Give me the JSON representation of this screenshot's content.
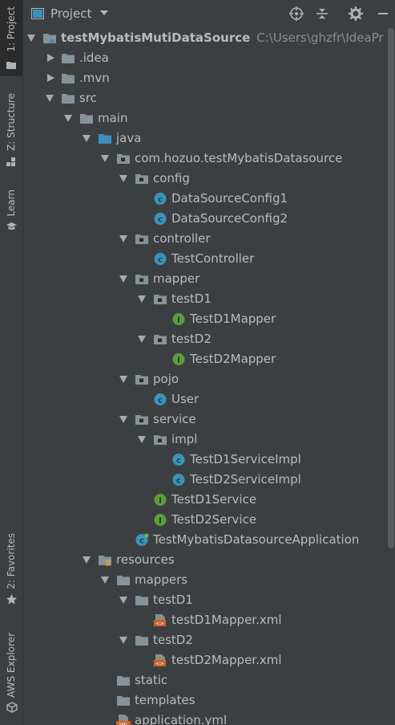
{
  "sidebar": {
    "tabs": [
      {
        "label": "1: Project",
        "icon": "folder-icon"
      },
      {
        "label": "Z: Structure",
        "icon": "structure-icon"
      },
      {
        "label": "Learn",
        "icon": "learn-cap-icon"
      },
      {
        "label": "2: Favorites",
        "icon": "star-icon"
      },
      {
        "label": "AWS Explorer",
        "icon": "aws-cube-icon"
      }
    ]
  },
  "header": {
    "title": "Project",
    "icons": [
      "locate-icon",
      "collapse-all-icon",
      "settings-gear-icon",
      "hide-minus-icon"
    ]
  },
  "tree": {
    "rows": [
      {
        "label": "testMybatisMutiDataSource",
        "extra": "C:\\Users\\ghzfr\\IdeaProjects",
        "icon": "module-folder-icon",
        "arrow": "down",
        "bold": true
      },
      {
        "label": ".idea",
        "icon": "folder-icon",
        "arrow": "right"
      },
      {
        "label": ".mvn",
        "icon": "folder-icon",
        "arrow": "right"
      },
      {
        "label": "src",
        "icon": "folder-icon",
        "arrow": "down"
      },
      {
        "label": "main",
        "icon": "folder-icon",
        "arrow": "down"
      },
      {
        "label": "java",
        "icon": "source-folder-icon",
        "arrow": "down"
      },
      {
        "label": "com.hozuo.testMybatisDatasource",
        "icon": "package-icon",
        "arrow": "down"
      },
      {
        "label": "config",
        "icon": "package-icon",
        "arrow": "down"
      },
      {
        "label": "DataSourceConfig1",
        "icon": "class-icon"
      },
      {
        "label": "DataSourceConfig2",
        "icon": "class-icon"
      },
      {
        "label": "controller",
        "icon": "package-icon",
        "arrow": "down"
      },
      {
        "label": "TestController",
        "icon": "class-icon"
      },
      {
        "label": "mapper",
        "icon": "package-icon",
        "arrow": "down"
      },
      {
        "label": "testD1",
        "icon": "package-icon",
        "arrow": "down"
      },
      {
        "label": "TestD1Mapper",
        "icon": "interface-icon"
      },
      {
        "label": "testD2",
        "icon": "package-icon",
        "arrow": "down"
      },
      {
        "label": "TestD2Mapper",
        "icon": "interface-icon"
      },
      {
        "label": "pojo",
        "icon": "package-icon",
        "arrow": "down"
      },
      {
        "label": "User",
        "icon": "class-icon"
      },
      {
        "label": "service",
        "icon": "package-icon",
        "arrow": "down"
      },
      {
        "label": "impl",
        "icon": "package-icon",
        "arrow": "down"
      },
      {
        "label": "TestD1ServiceImpl",
        "icon": "class-icon"
      },
      {
        "label": "TestD2ServiceImpl",
        "icon": "class-icon"
      },
      {
        "label": "TestD1Service",
        "icon": "interface-icon"
      },
      {
        "label": "TestD2Service",
        "icon": "interface-icon"
      },
      {
        "label": "TestMybatisDatasourceApplication",
        "icon": "spring-class-icon"
      },
      {
        "label": "resources",
        "icon": "resources-folder-icon",
        "arrow": "down"
      },
      {
        "label": "mappers",
        "icon": "folder-icon",
        "arrow": "down"
      },
      {
        "label": "testD1",
        "icon": "folder-icon",
        "arrow": "down"
      },
      {
        "label": "testD1Mapper.xml",
        "icon": "xml-file-icon"
      },
      {
        "label": "testD2",
        "icon": "folder-icon",
        "arrow": "down"
      },
      {
        "label": "testD2Mapper.xml",
        "icon": "xml-file-icon"
      },
      {
        "label": "static",
        "icon": "folder-icon"
      },
      {
        "label": "templates",
        "icon": "folder-icon"
      },
      {
        "label": "application.yml",
        "icon": "yml-file-icon",
        "badge": "YML"
      }
    ]
  },
  "colors": {
    "class": "#3a95b8",
    "interface": "#5e9d3f",
    "folder": "#87939a",
    "source_folder": "#3d8fc1",
    "xml": "#c8642c"
  }
}
